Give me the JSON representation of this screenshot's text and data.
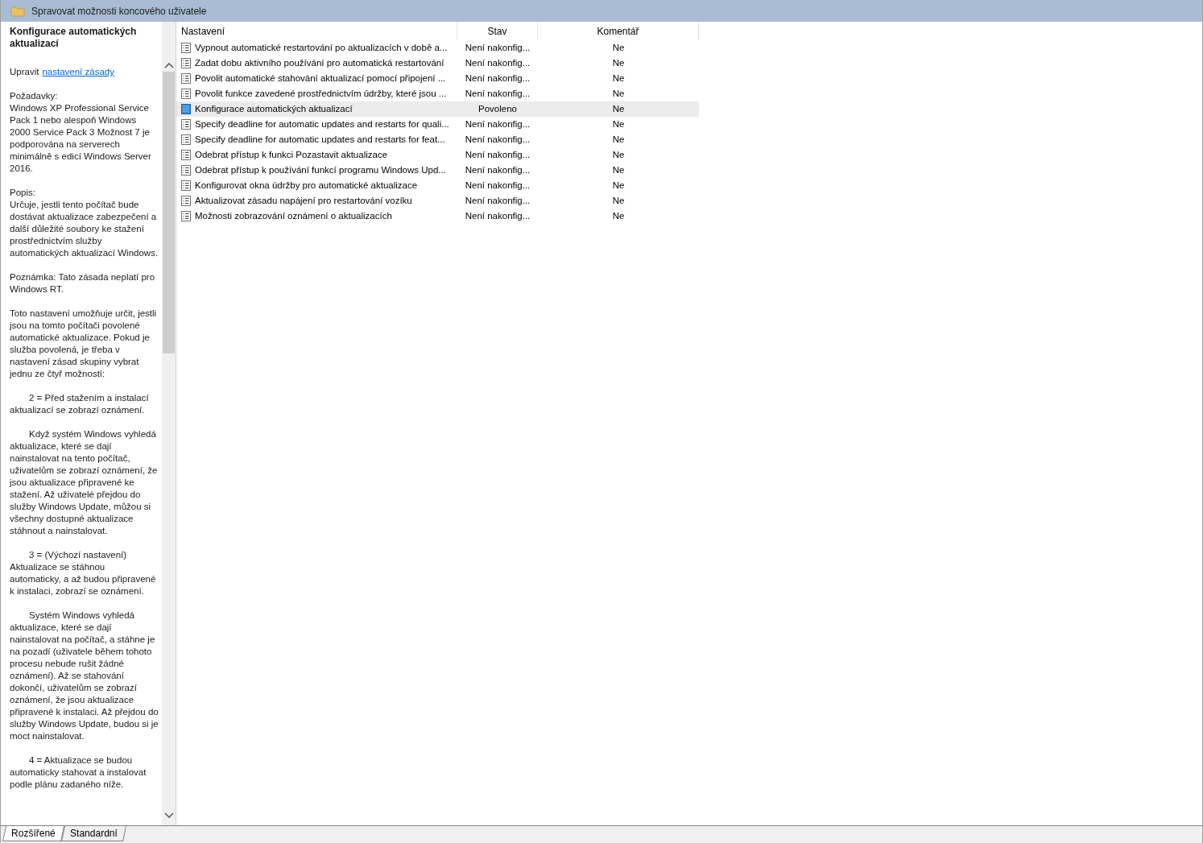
{
  "window": {
    "title": "Spravovat možnosti koncového uživatele"
  },
  "description": {
    "title": "Konfigurace automatických aktualizací",
    "edit_prefix": "Upravit",
    "edit_link": "nastavení zásady",
    "paragraphs": [
      {
        "text": "Požadavky:\nWindows XP Professional Service Pack 1 nebo alespoň Windows 2000 Service Pack 3 Možnost 7 je podporována na serverech minimálně s edicí Windows Server 2016.",
        "indent": false
      },
      {
        "text": "Popis:\nUrčuje, jestli tento počítač bude dostávat aktualizace zabezpečení a další důležité soubory ke stažení prostřednictvím služby automatických aktualizací Windows.",
        "indent": false
      },
      {
        "text": "Poznámka: Tato zásada neplatí pro Windows RT.",
        "indent": false
      },
      {
        "text": "Toto nastavení umožňuje určit, jestli jsou na tomto počítači povolené automatické aktualizace. Pokud je služba povolená, je třeba v nastavení zásad skupiny vybrat jednu ze čtyř možností:",
        "indent": false
      },
      {
        "text": "2 = Před stažením a instalací aktualizací se zobrazí oznámení.",
        "indent": true
      },
      {
        "text": "Když systém Windows vyhledá aktualizace, které se dají nainstalovat na tento počítač, uživatelům se zobrazí oznámení, že jsou aktualizace připravené ke stažení. Až uživatelé přejdou do služby Windows Update, můžou si všechny dostupné aktualizace stáhnout a nainstalovat.",
        "indent": true
      },
      {
        "text": "3 = (Výchozí nastavení) Aktualizace se stáhnou automaticky, a až budou připravené k instalaci, zobrazí se oznámení.",
        "indent": true
      },
      {
        "text": "Systém Windows vyhledá aktualizace, které se dají nainstalovat na počítač, a stáhne je na pozadí (uživatele během tohoto procesu nebude rušit žádné oznámení). Až se stahování dokončí, uživatelům se zobrazí oznámení, že jsou aktualizace připravené k instalaci. Až přejdou do služby Windows Update, budou si je moct nainstalovat.",
        "indent": true
      },
      {
        "text": "4 = Aktualizace se budou automaticky stahovat a instalovat podle plánu zadaného níže.",
        "indent": true
      }
    ]
  },
  "table": {
    "columns": [
      "Nastavení",
      "Stav",
      "Komentář"
    ],
    "rows": [
      {
        "name": "Vypnout automatické restartování po aktualizacích v době a...",
        "state": "Není nakonfig...",
        "comment": "Ne",
        "enabled": false,
        "selected": false
      },
      {
        "name": "Zadat dobu aktivního používání pro automatická restartování",
        "state": "Není nakonfig...",
        "comment": "Ne",
        "enabled": false,
        "selected": false
      },
      {
        "name": "Povolit automatické stahování aktualizací pomocí připojení ...",
        "state": "Není nakonfig...",
        "comment": "Ne",
        "enabled": false,
        "selected": false
      },
      {
        "name": "Povolit funkce zavedené prostřednictvím údržby, které jsou ...",
        "state": "Není nakonfig...",
        "comment": "Ne",
        "enabled": false,
        "selected": false
      },
      {
        "name": "Konfigurace automatických aktualizací",
        "state": "Povoleno",
        "comment": "Ne",
        "enabled": true,
        "selected": true
      },
      {
        "name": "Specify deadline for automatic updates and restarts for quali...",
        "state": "Není nakonfig...",
        "comment": "Ne",
        "enabled": false,
        "selected": false
      },
      {
        "name": "Specify deadline for automatic updates and restarts for feat...",
        "state": "Není nakonfig...",
        "comment": "Ne",
        "enabled": false,
        "selected": false
      },
      {
        "name": "Odebrat přístup k funkci Pozastavit aktualizace",
        "state": "Není nakonfig...",
        "comment": "Ne",
        "enabled": false,
        "selected": false
      },
      {
        "name": "Odebrat přístup k používání funkcí programu Windows Upd...",
        "state": "Není nakonfig...",
        "comment": "Ne",
        "enabled": false,
        "selected": false
      },
      {
        "name": "Konfigurovat okna údržby pro automatické aktualizace",
        "state": "Není nakonfig...",
        "comment": "Ne",
        "enabled": false,
        "selected": false
      },
      {
        "name": "Aktualizovat zásadu napájení pro restartování vozíku",
        "state": "Není nakonfig...",
        "comment": "Ne",
        "enabled": false,
        "selected": false
      },
      {
        "name": "Možnosti zobrazování oznámení o aktualizacích",
        "state": "Není nakonfig...",
        "comment": "Ne",
        "enabled": false,
        "selected": false
      }
    ]
  },
  "tabs": [
    {
      "label": "Rozšířené",
      "selected": true
    },
    {
      "label": "Standardní",
      "selected": false
    }
  ]
}
